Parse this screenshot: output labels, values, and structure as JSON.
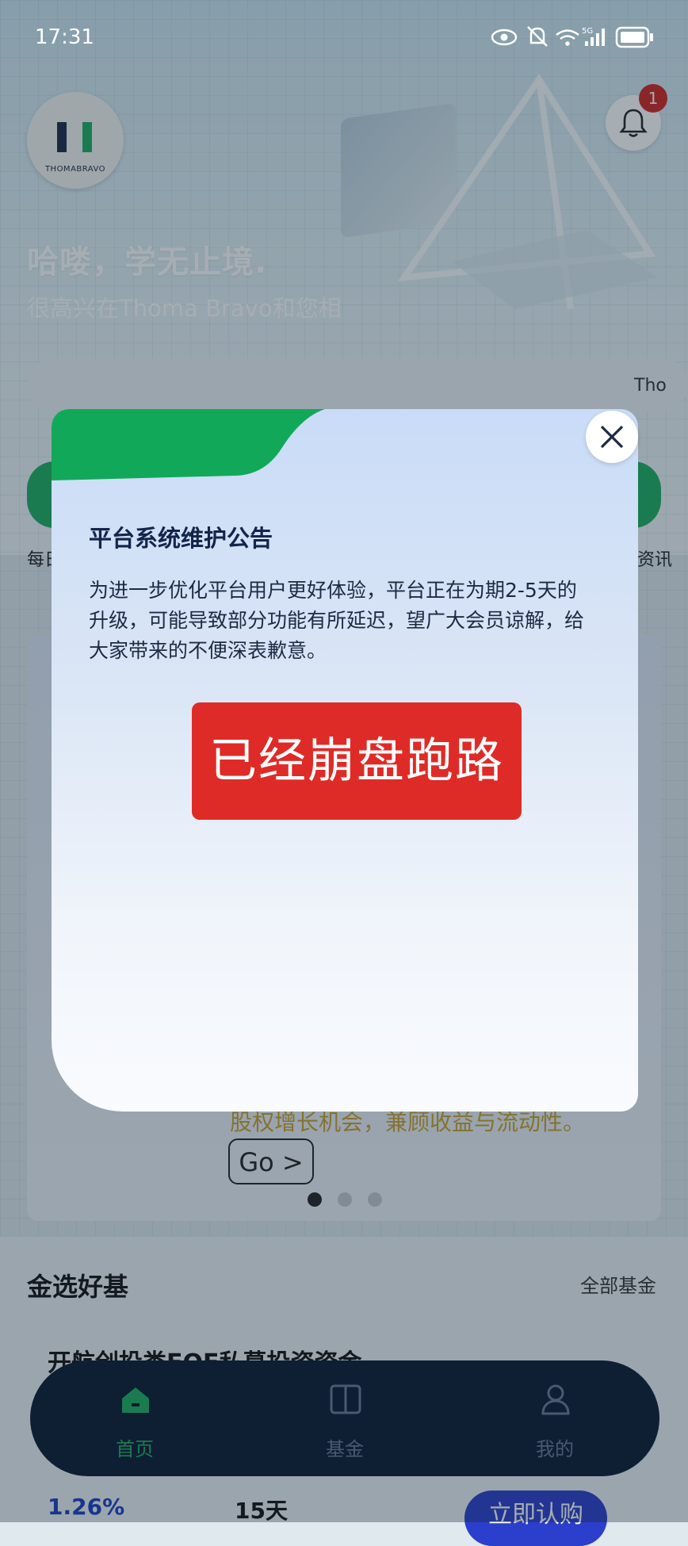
{
  "status_bar": {
    "time": "17:31",
    "network": "5G"
  },
  "header": {
    "logo_text": "THOMABRAVO",
    "notification_count": "1",
    "greeting": "哈喽，学无止境.",
    "greeting_sub": "很高兴在Thoma Bravo和您相",
    "search_hint": "Tho"
  },
  "quick_links": {
    "left_label": "每日",
    "right_label": "资讯"
  },
  "banner": {
    "text": "股权增长机会，兼顾收益与流动性。",
    "go_label": "Go >"
  },
  "section": {
    "title": "金选好基",
    "more": "全部基金"
  },
  "fund": {
    "name": "开航创投类FOF私募投资资金",
    "rate": "1.26%",
    "days": "15天",
    "buy_label": "立即认购"
  },
  "bottom_nav": {
    "items": [
      {
        "label": "首页",
        "active": true
      },
      {
        "label": "基金",
        "active": false
      },
      {
        "label": "我的",
        "active": false
      }
    ]
  },
  "modal": {
    "title": "平台系统维护公告",
    "body": "为进一步优化平台用户更好体验，平台正在为期2-5天的升级，可能导致部分功能有所延迟，望广大会员谅解，给大家带来的不便深表歉意。",
    "red_label": "已经崩盘跑路"
  },
  "colors": {
    "accent_green": "#1fae5f",
    "red": "#df2b27",
    "nav_bg": "#0b1a33",
    "blue": "#2b3ecc"
  }
}
